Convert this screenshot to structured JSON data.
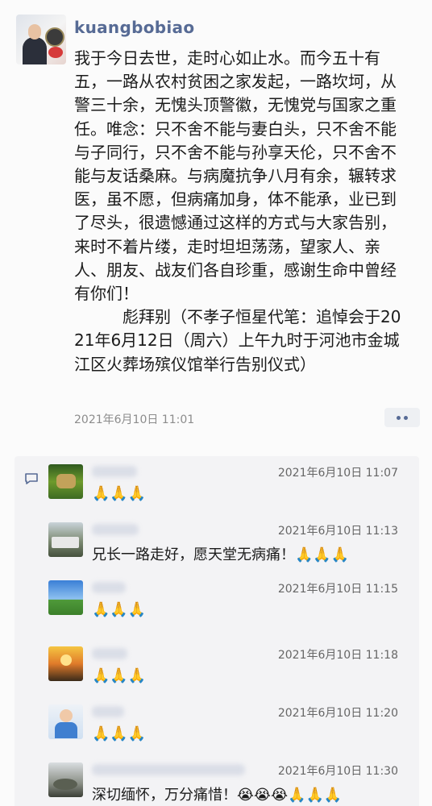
{
  "post": {
    "username": "kuangbobiao",
    "text": "我于今日去世，走时心如止水。而今五十有五，一路从农村贫困之家发起，一路坎坷，从警三十余，无愧头顶警徽，无愧党与国家之重任。唯念：只不舍不能与妻白头，只不舍不能与子同行，只不舍不能与孙享天伦，只不舍不能与友话桑麻。与病魔抗争八月有余，辗转求医，虽不愿，但病痛加身，体不能承，业已到了尽头，很遗憾通过这样的方式与大家告别，来时不着片缕，走时坦坦荡荡，望家人、亲人、朋友、战友们各自珍重，感谢生命中曾经有你们！\n　　　彪拜别（不孝子恒星代笔：追悼会于2021年6月12日（周六）上午九时于河池市金城江区火葬场殡仪馆举行告别仪式）",
    "time": "2021年6月10日 11:01",
    "more_icon": "more-dots-icon"
  },
  "comments_icon": "comment-bubble-icon",
  "comments": [
    {
      "time": "2021年6月10日 11:07",
      "text": "🙏🙏🙏",
      "name_redacted": true
    },
    {
      "time": "2021年6月10日 11:13",
      "text": "兄长一路走好，愿天堂无病痛！🙏🙏🙏",
      "name_redacted": true
    },
    {
      "time": "2021年6月10日 11:15",
      "text": "🙏🙏🙏",
      "name_redacted": true
    },
    {
      "time": "2021年6月10日 11:18",
      "text": "🙏🙏🙏",
      "name_redacted": true
    },
    {
      "time": "2021年6月10日 11:20",
      "text": "🙏🙏🙏",
      "name_redacted": true
    },
    {
      "time": "2021年6月10日 11:30",
      "text": "深切缅怀，万分痛惜！😭😭😭🙏🙏🙏",
      "name_redacted": true
    }
  ],
  "colors": {
    "username": "#576b95",
    "meta_text": "#8c8c8c",
    "comments_bg": "#f3f3f5"
  }
}
